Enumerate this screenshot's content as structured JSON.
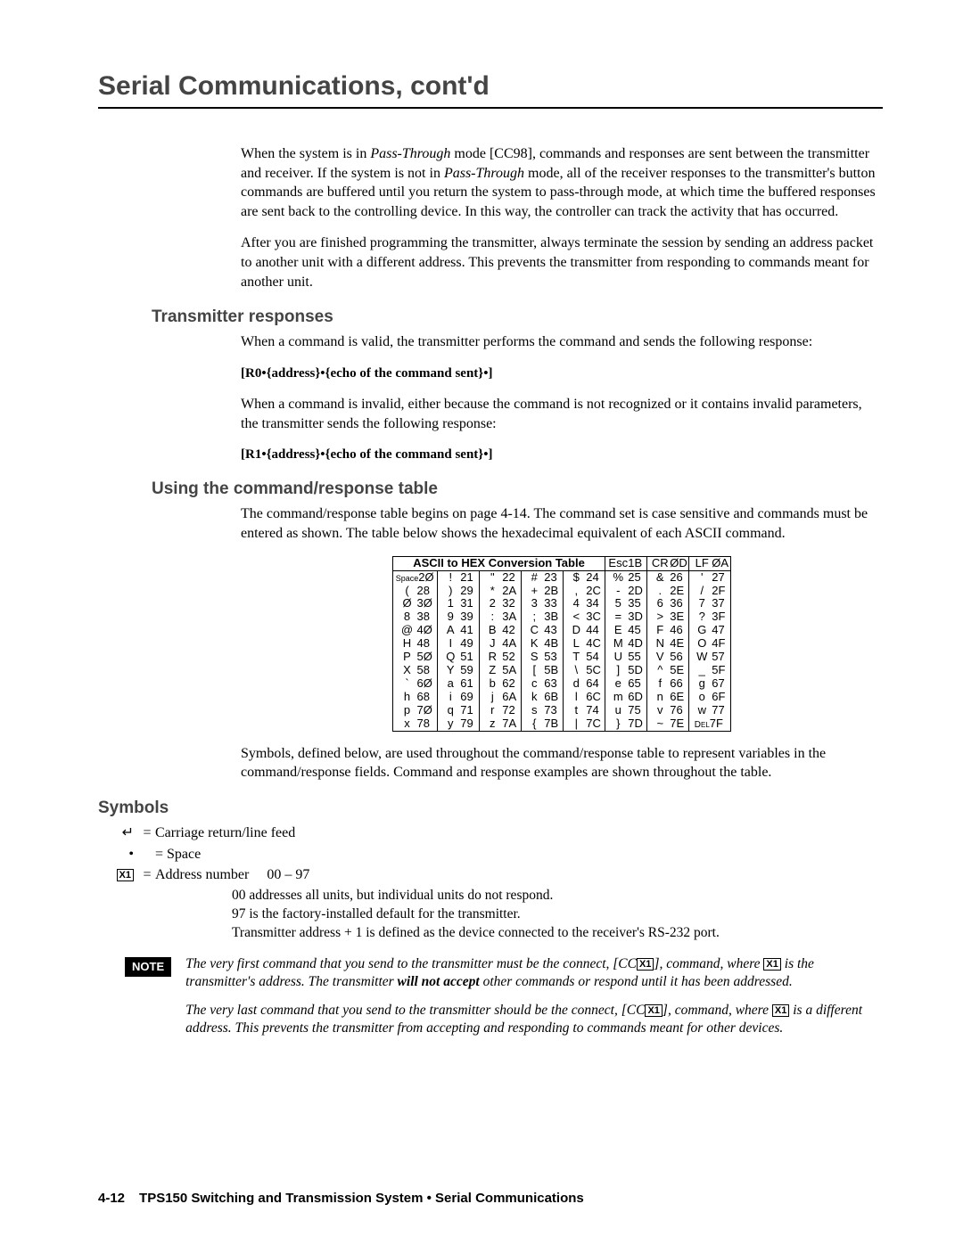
{
  "chapter_title": "Serial Communications, cont'd",
  "paragraphs": {
    "p1a": "When the system is in ",
    "p1_em1": "Pass-Through",
    "p1b": " mode [CC98], commands and responses are sent between the transmitter and receiver.  If the system is not in ",
    "p1_em2": "Pass-Through",
    "p1c": " mode, all of the receiver responses to the transmitter's button commands are buffered until you return the system to pass-through mode, at which time the buffered responses are sent back to the controlling device.  In this way, the controller can track the activity that has occurred.",
    "p2": "After you are finished programming the transmitter, always terminate the session by sending an address packet to another unit with a different address.  This prevents the transmitter from responding to commands meant for another unit.",
    "h_transmitter": "Transmitter responses",
    "p3": "When a command is valid, the transmitter performs the command and sends the following response:",
    "cmd1": "[R0•{address}•{echo of the command sent}•]",
    "p4": "When a command is invalid, either because the command is not recognized or it contains invalid parameters, the transmitter sends the following response:",
    "cmd2": "[R1•{address}•{echo of the command sent}•]",
    "h_using": "Using the command/response table",
    "p5": "The command/response table begins on page 4-14.  The command set is case sensitive and commands must be entered as shown.  The table below shows the hexadecimal equivalent of each ASCII command.",
    "p6": "Symbols, defined below, are used throughout the command/response table to represent variables in the command/response fields.  Command and response examples are shown throughout the table.",
    "h_symbols": "Symbols"
  },
  "ascii_table": {
    "title": "ASCII to HEX  Conversion Table",
    "header_extra": [
      [
        "Esc",
        "1B"
      ],
      [
        "CR",
        "ØD"
      ],
      [
        "LF",
        "ØA"
      ]
    ],
    "rows": [
      [
        [
          "Space",
          "2Ø"
        ],
        [
          "!",
          "21"
        ],
        [
          "\"",
          "22"
        ],
        [
          "#",
          "23"
        ],
        [
          "$",
          "24"
        ],
        [
          "%",
          "25"
        ],
        [
          "&",
          "26"
        ],
        [
          "'",
          "27"
        ]
      ],
      [
        [
          "(",
          "28"
        ],
        [
          ")",
          "29"
        ],
        [
          "*",
          "2A"
        ],
        [
          "+",
          "2B"
        ],
        [
          ",",
          "2C"
        ],
        [
          "-",
          "2D"
        ],
        [
          ".",
          "2E"
        ],
        [
          "/",
          "2F"
        ]
      ],
      [
        [
          "Ø",
          "3Ø"
        ],
        [
          "1",
          "31"
        ],
        [
          "2",
          "32"
        ],
        [
          "3",
          "33"
        ],
        [
          "4",
          "34"
        ],
        [
          "5",
          "35"
        ],
        [
          "6",
          "36"
        ],
        [
          "7",
          "37"
        ]
      ],
      [
        [
          "8",
          "38"
        ],
        [
          "9",
          "39"
        ],
        [
          ":",
          "3A"
        ],
        [
          ";",
          "3B"
        ],
        [
          "<",
          "3C"
        ],
        [
          "=",
          "3D"
        ],
        [
          ">",
          "3E"
        ],
        [
          "?",
          "3F"
        ]
      ],
      [
        [
          "@",
          "4Ø"
        ],
        [
          "A",
          "41"
        ],
        [
          "B",
          "42"
        ],
        [
          "C",
          "43"
        ],
        [
          "D",
          "44"
        ],
        [
          "E",
          "45"
        ],
        [
          "F",
          "46"
        ],
        [
          "G",
          "47"
        ]
      ],
      [
        [
          "H",
          "48"
        ],
        [
          "I",
          "49"
        ],
        [
          "J",
          "4A"
        ],
        [
          "K",
          "4B"
        ],
        [
          "L",
          "4C"
        ],
        [
          "M",
          "4D"
        ],
        [
          "N",
          "4E"
        ],
        [
          "O",
          "4F"
        ]
      ],
      [
        [
          "P",
          "5Ø"
        ],
        [
          "Q",
          "51"
        ],
        [
          "R",
          "52"
        ],
        [
          "S",
          "53"
        ],
        [
          "T",
          "54"
        ],
        [
          "U",
          "55"
        ],
        [
          "V",
          "56"
        ],
        [
          "W",
          "57"
        ]
      ],
      [
        [
          "X",
          "58"
        ],
        [
          "Y",
          "59"
        ],
        [
          "Z",
          "5A"
        ],
        [
          "[",
          "5B"
        ],
        [
          "\\",
          "5C"
        ],
        [
          "]",
          "5D"
        ],
        [
          "^",
          "5E"
        ],
        [
          "_",
          "5F"
        ]
      ],
      [
        [
          "`",
          "6Ø"
        ],
        [
          "a",
          "61"
        ],
        [
          "b",
          "62"
        ],
        [
          "c",
          "63"
        ],
        [
          "d",
          "64"
        ],
        [
          "e",
          "65"
        ],
        [
          "f",
          "66"
        ],
        [
          "g",
          "67"
        ]
      ],
      [
        [
          "h",
          "68"
        ],
        [
          "i",
          "69"
        ],
        [
          "j",
          "6A"
        ],
        [
          "k",
          "6B"
        ],
        [
          "l",
          "6C"
        ],
        [
          "m",
          "6D"
        ],
        [
          "n",
          "6E"
        ],
        [
          "o",
          "6F"
        ]
      ],
      [
        [
          "p",
          "7Ø"
        ],
        [
          "q",
          "71"
        ],
        [
          "r",
          "72"
        ],
        [
          "s",
          "73"
        ],
        [
          "t",
          "74"
        ],
        [
          "u",
          "75"
        ],
        [
          "v",
          "76"
        ],
        [
          "w",
          "77"
        ]
      ],
      [
        [
          "x",
          "78"
        ],
        [
          "y",
          "79"
        ],
        [
          "z",
          "7A"
        ],
        [
          "{",
          "7B"
        ],
        [
          "|",
          "7C"
        ],
        [
          "}",
          "7D"
        ],
        [
          "~",
          "7E"
        ],
        [
          "DEL",
          "7F"
        ]
      ]
    ]
  },
  "symbols": {
    "s1_left": "↵",
    "s1_right": "Carriage return/line feed",
    "s2_left": "•",
    "s2_right": "= Space",
    "s3_box": "X1",
    "s3_right_a": "Address number",
    "s3_right_b": "00 – 97",
    "s3_note1": "00 addresses all units, but individual units do not respond.",
    "s3_note2": "97 is the factory-installed default for the transmitter.",
    "s3_note3": "Transmitter address + 1 is defined as the device connected to the receiver's RS-232 port."
  },
  "note": {
    "label": "NOTE",
    "p1a": "The very first command that you send to the transmitter must be the connect, [CC",
    "p1_box": "X1",
    "p1b": "], command, where ",
    "p1_box2": "X1",
    "p1c": " is the transmitter's address.  The transmitter ",
    "p1_strong": "will not accept",
    "p1d": " other commands or respond until it has been addressed.",
    "p2a": "The very last command that you send to the transmitter should be the connect, [CC",
    "p2_box": "X1",
    "p2b": "], command, where ",
    "p2_box2": "X1",
    "p2c": " is a different address.  This prevents the transmitter from accepting and responding to commands meant for other devices."
  },
  "footer": {
    "page": "4-12",
    "text": "TPS150 Switching and Transmission System • Serial Communications"
  }
}
